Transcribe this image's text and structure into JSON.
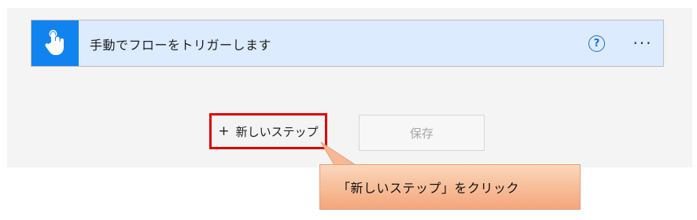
{
  "trigger": {
    "title": "手動でフローをトリガーします",
    "icon": "hand-tap-icon",
    "help_glyph": "?",
    "more_glyph": "···"
  },
  "actions": {
    "new_step_plus": "+",
    "new_step_label": "新しいステップ",
    "save_label": "保存"
  },
  "callout": {
    "text": "「新しいステップ」をクリック"
  },
  "colors": {
    "trigger_bg": "#dcebfd",
    "trigger_icon_bg": "#1183ee",
    "highlight": "#e00000",
    "callout_fill": "#f4a57a"
  }
}
